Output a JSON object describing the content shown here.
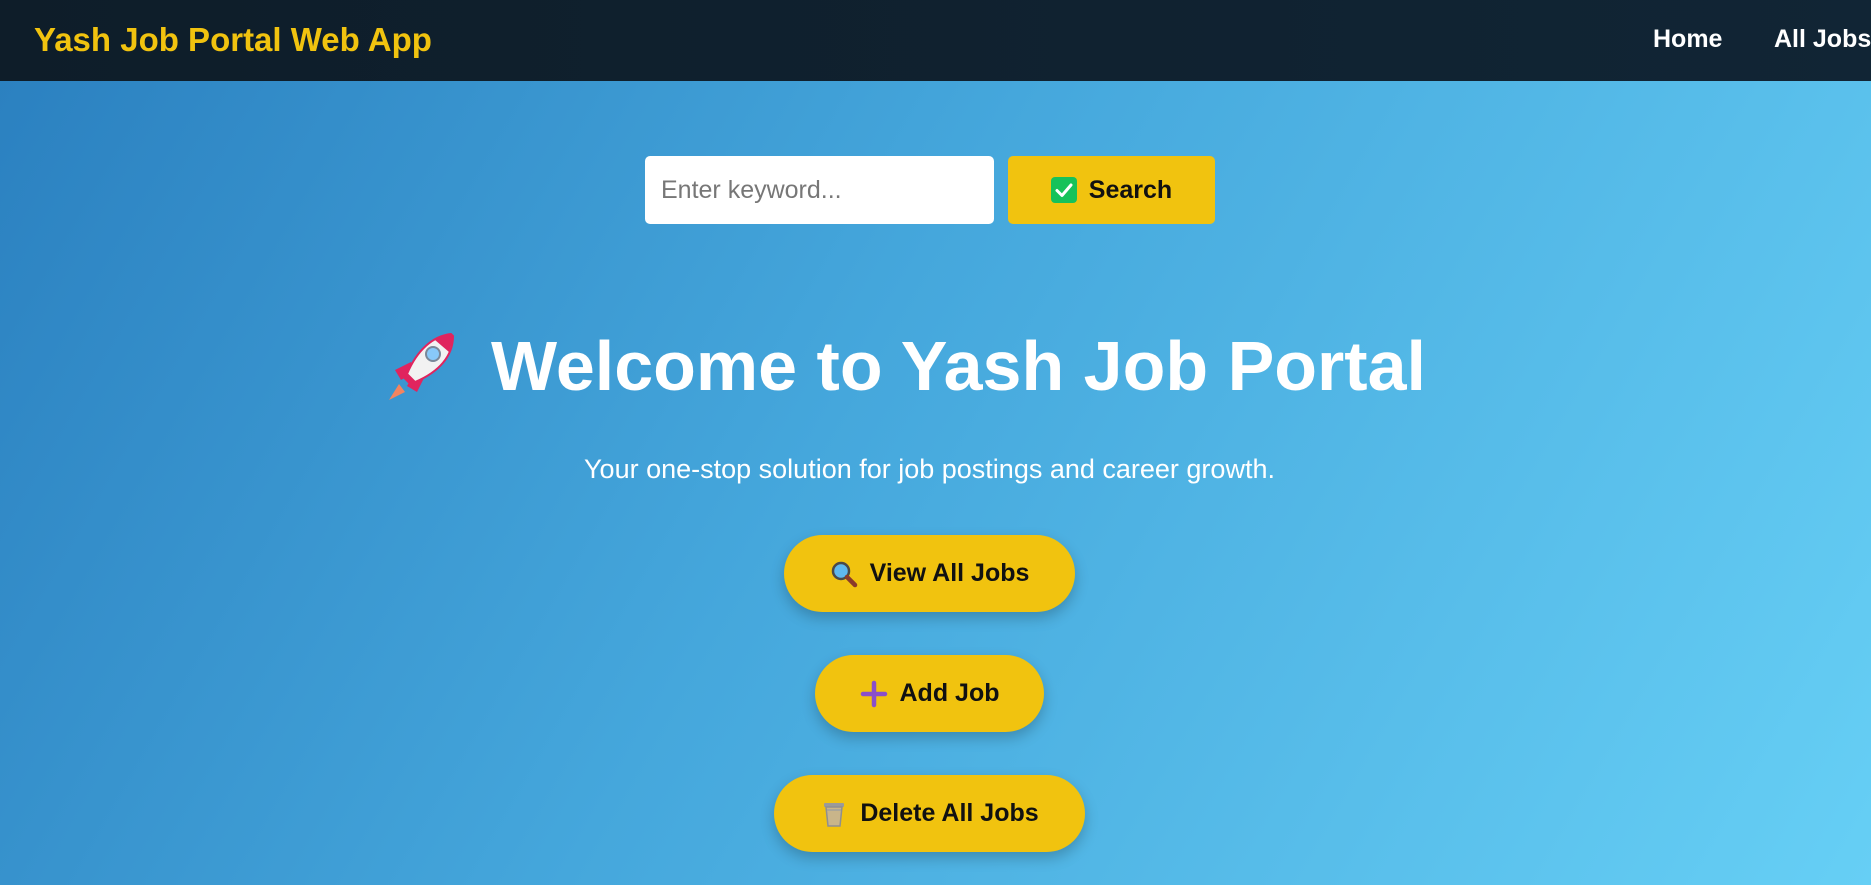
{
  "navbar": {
    "brand": "Yash Job Portal Web App",
    "links": [
      {
        "label": "Home"
      },
      {
        "label": "All Jobs"
      }
    ]
  },
  "search": {
    "placeholder": "Enter keyword...",
    "value": "",
    "button_label": "Search",
    "button_icon": "check-mark-icon"
  },
  "hero": {
    "icon": "rocket-icon",
    "title": "Welcome to Yash Job Portal",
    "subtitle": "Your one-stop solution for job postings and career growth."
  },
  "actions": [
    {
      "label": "View All Jobs",
      "icon": "magnifier-icon"
    },
    {
      "label": "Add Job",
      "icon": "plus-icon"
    },
    {
      "label": "Delete All Jobs",
      "icon": "wastebasket-icon"
    }
  ],
  "colors": {
    "accent": "#f1c30f",
    "navbar": "#0e1d29",
    "gradient_start": "#2a7fbf",
    "gradient_end": "#66cff5",
    "check_green": "#16c25a",
    "plus_purple": "#8a4fc9"
  }
}
